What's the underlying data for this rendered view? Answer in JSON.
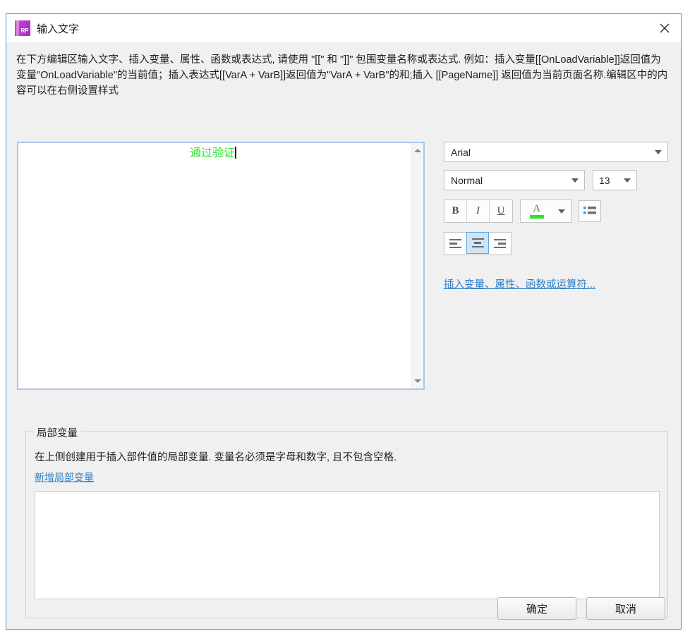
{
  "window": {
    "title": "输入文字",
    "app_icon_label": "RP",
    "close_icon": "close-icon"
  },
  "intro": {
    "text": "在下方编辑区输入文字、插入变量、属性、函数或表达式, 请使用 \"[[\" 和 \"]]\" 包围变量名称或表达式. 例如：插入变量[[OnLoadVariable]]返回值为变量\"OnLoadVariable\"的当前值；插入表达式[[VarA + VarB]]返回值为\"VarA + VarB\"的和;插入 [[PageName]] 返回值为当前页面名称.编辑区中的内容可以在右侧设置样式"
  },
  "editor": {
    "content": "通过验证",
    "text_color": "#2ae52a",
    "align": "center",
    "scroll_up_icon": "triangle-up-icon",
    "scroll_down_icon": "triangle-down-icon"
  },
  "format_panel": {
    "font_family": "Arial",
    "font_style": "Normal",
    "font_size": "13",
    "bold_label": "B",
    "italic_label": "I",
    "underline_label": "U",
    "color_glyph": "A",
    "color_value": "#2ae52a",
    "list_icon": "bullet-list-icon",
    "align_left_icon": "align-left-icon",
    "align_center_icon": "align-center-icon",
    "align_right_icon": "align-right-icon",
    "selected_align": "center",
    "insert_link": "插入变量、属性、函数或运算符..."
  },
  "local_variables": {
    "group_title": "局部变量",
    "description": "在上侧创建用于插入部件值的局部变量. 变量名必须是字母和数字, 且不包含空格.",
    "add_link": "新增局部变量",
    "items": []
  },
  "footer": {
    "ok_label": "确定",
    "cancel_label": "取消"
  }
}
